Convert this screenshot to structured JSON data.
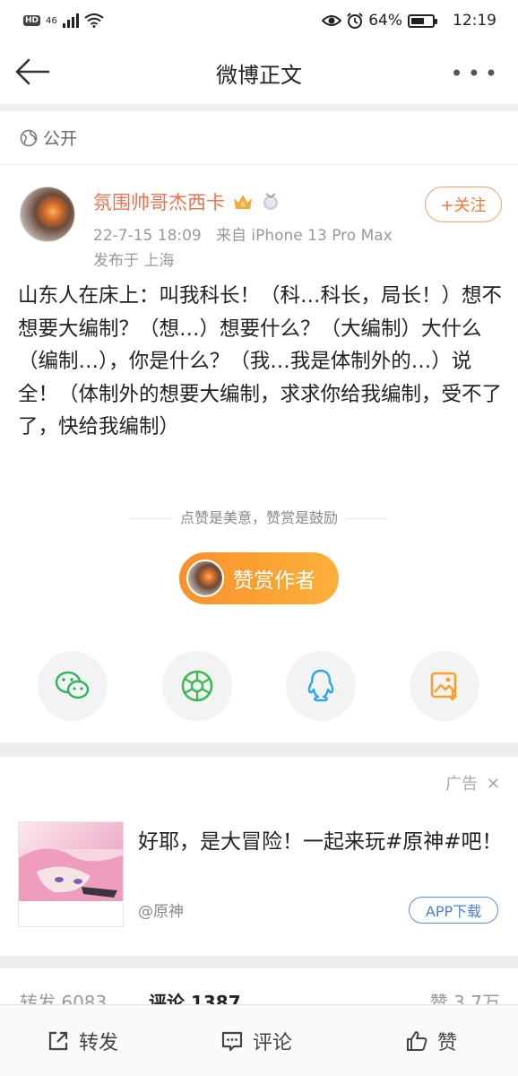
{
  "status_bar": {
    "hd": "HD",
    "network": "46",
    "battery": "64%",
    "battery_level": 0.64,
    "time": "12:19"
  },
  "header": {
    "title": "微博正文"
  },
  "post": {
    "visibility": "公开",
    "author_name": "氛围帅哥杰西卡",
    "timestamp": "22-7-15 18:09",
    "source": "来自 iPhone 13 Pro Max",
    "location": "发布于 上海",
    "follow_label": "+关注",
    "text": "山东人在床上：叫我科长！（科…科长，局长！）想不想要大编制？（想…）想要什么？（大编制）大什么（编制…），你是什么？（我…我是体制外的…）说全！（体制外的想要大编制，求求你给我编制，受不了了，快给我编制）",
    "encourage": "点赞是美意，赞赏是鼓励",
    "reward_label": "赞赏作者"
  },
  "share_icons": [
    "wechat-icon",
    "moments-icon",
    "qq-icon",
    "save-image-icon"
  ],
  "ad": {
    "label": "广告",
    "close": "✕",
    "title": "好耶，是大冒险！一起来玩#原神#吧！",
    "source": "@原神",
    "button": "APP下载"
  },
  "stats": {
    "repost": "转发 6083",
    "comment": "评论 1387",
    "like": "赞 3.7万"
  },
  "bottom_bar": {
    "repost": "转发",
    "comment": "评论",
    "like": "赞"
  },
  "colors": {
    "accent_orange": "#f07a32",
    "name_orange": "#eb7350",
    "link_blue": "#4a7fd9"
  }
}
